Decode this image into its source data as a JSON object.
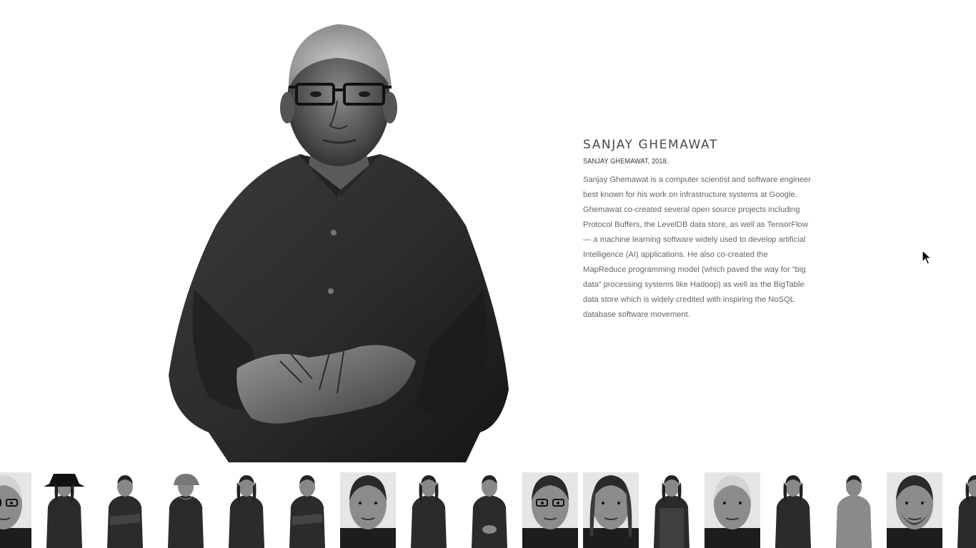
{
  "profile": {
    "name": "SANJAY GHEMAWAT",
    "caption": "SANJAY GHEMAWAT, 2018.",
    "bio": "Sanjay Ghemawat is a computer scientist and software engineer best known for his work on infrastructure systems at Google. Ghemawat co-created several open source projects including Protocol Buffers, the LevelDB data store, as well as TensorFlow — a machine learning software widely used to develop artificial Intelligence (AI) applications. He also co-created the MapReduce programming model (which paved the way for “big data” processing systems like Hadoop) as well as the BigTable data store which is widely credited with inspiring the NoSQL database software movement."
  },
  "colors": {
    "background": "#ffffff",
    "title": "#4a4a4a",
    "body_text": "#666666",
    "photo_dark": "#1f1f1f",
    "photo_mid": "#6b6b6b"
  },
  "thumbnails": [
    {
      "name": "thumb-portrait-1",
      "style": "bald-glasses-closeup",
      "selected": false
    },
    {
      "name": "thumb-portrait-2",
      "style": "woman-hat-glasses",
      "selected": false
    },
    {
      "name": "thumb-portrait-3",
      "style": "man-arms-crossed",
      "selected": false
    },
    {
      "name": "thumb-portrait-4",
      "style": "man-cap-beard",
      "selected": false
    },
    {
      "name": "thumb-portrait-5",
      "style": "woman-standing",
      "selected": false
    },
    {
      "name": "thumb-portrait-6",
      "style": "man-arms-crossed",
      "selected": false
    },
    {
      "name": "thumb-portrait-7",
      "style": "man-closeup",
      "selected": false
    },
    {
      "name": "thumb-portrait-8",
      "style": "woman-hand-chin",
      "selected": false
    },
    {
      "name": "thumb-portrait-9",
      "style": "man-hands-clasped",
      "selected": true
    },
    {
      "name": "thumb-portrait-10",
      "style": "man-glasses-closeup",
      "selected": false
    },
    {
      "name": "thumb-portrait-11",
      "style": "woman-closeup",
      "selected": false
    },
    {
      "name": "thumb-portrait-12",
      "style": "woman-standing-long",
      "selected": false
    },
    {
      "name": "thumb-portrait-13",
      "style": "elderly-man-closeup",
      "selected": false
    },
    {
      "name": "thumb-portrait-14",
      "style": "woman-standing",
      "selected": false
    },
    {
      "name": "thumb-portrait-15",
      "style": "man-tshirt",
      "selected": false
    },
    {
      "name": "thumb-portrait-16",
      "style": "man-beard-closeup",
      "selected": false
    },
    {
      "name": "thumb-portrait-17",
      "style": "woman-partial",
      "selected": false
    }
  ],
  "icons": {
    "cursor": "arrow-cursor-icon"
  }
}
